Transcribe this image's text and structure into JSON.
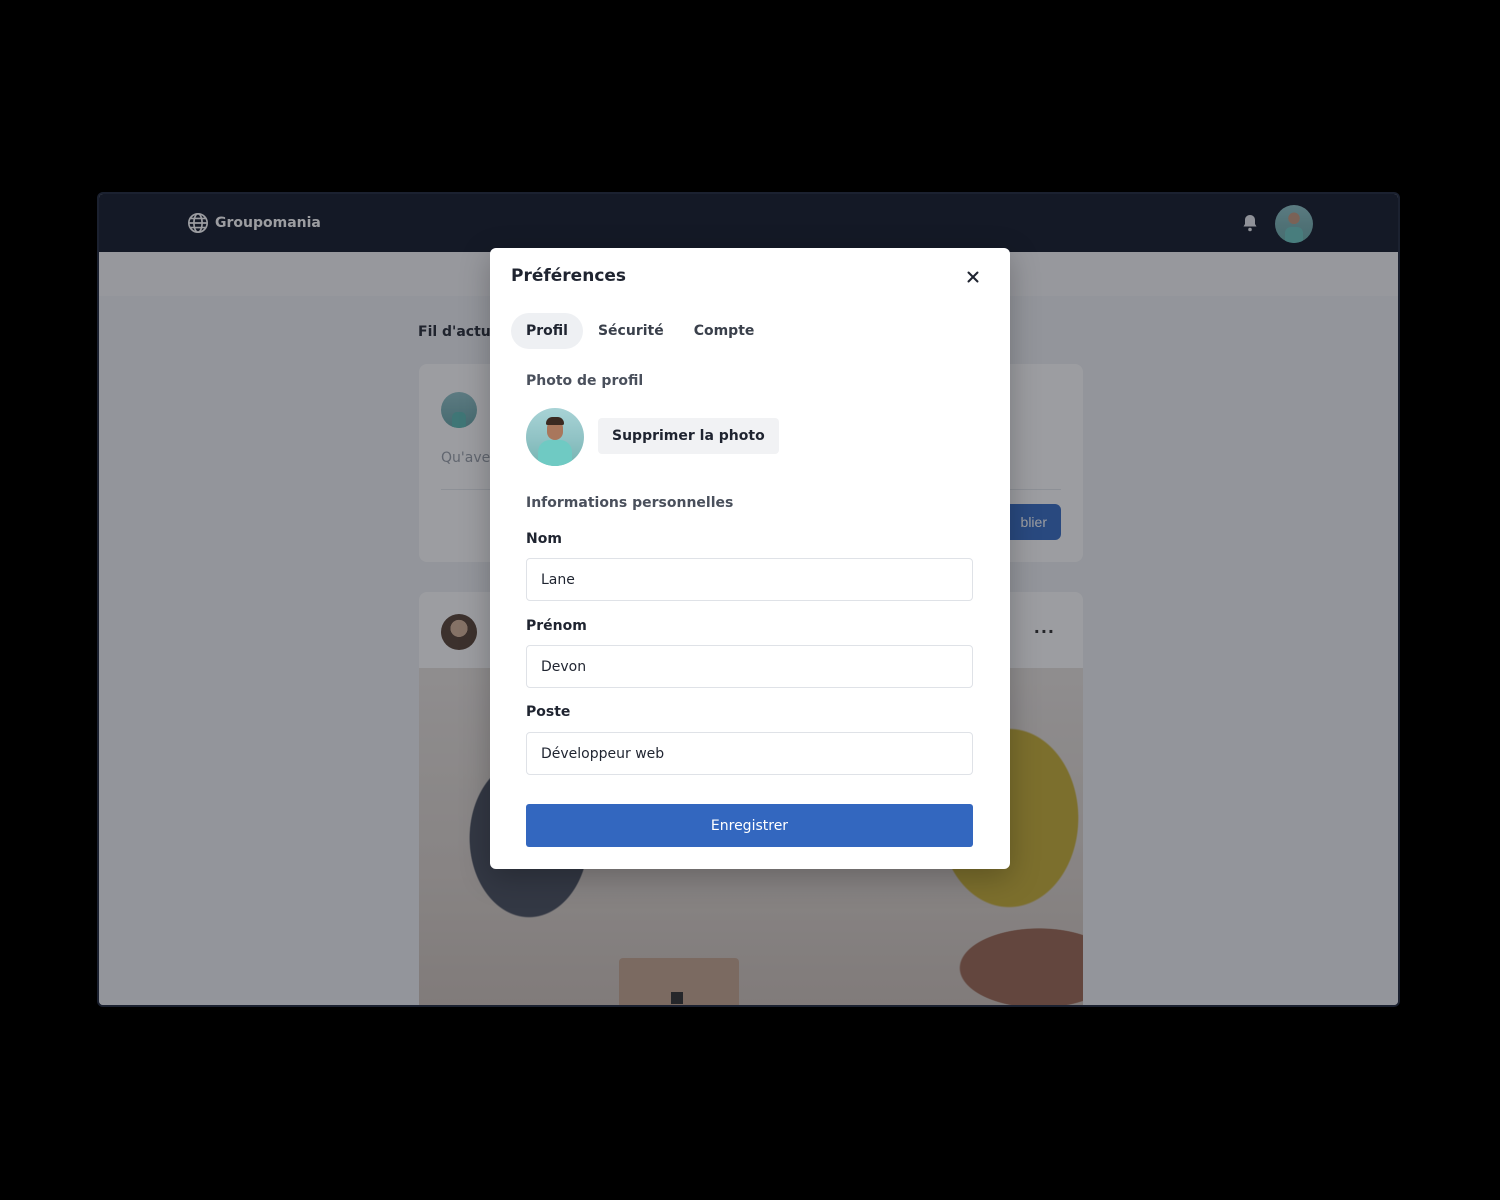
{
  "app": {
    "brand": "Groupomania",
    "feed_title": "Fil d'actua",
    "composer_placeholder": "Qu'ave",
    "publish_label": "blier",
    "post_more": "···"
  },
  "modal": {
    "title": "Préférences",
    "tabs": [
      {
        "label": "Profil",
        "active": true
      },
      {
        "label": "Sécurité",
        "active": false
      },
      {
        "label": "Compte",
        "active": false
      }
    ],
    "photo_section": "Photo de profil",
    "remove_photo_label": "Supprimer la photo",
    "info_section": "Informations personnelles",
    "fields": {
      "nom": {
        "label": "Nom",
        "value": "Lane"
      },
      "prenom": {
        "label": "Prénom",
        "value": "Devon"
      },
      "poste": {
        "label": "Poste",
        "value": "Développeur web"
      }
    },
    "save_label": "Enregistrer"
  },
  "colors": {
    "topbar": "#161c2c",
    "primary": "#3367bf",
    "overlay": "rgba(18,22,30,0.42)"
  },
  "icons": {
    "brand": "globe-icon",
    "notifications": "bell-icon",
    "close": "close-icon"
  }
}
